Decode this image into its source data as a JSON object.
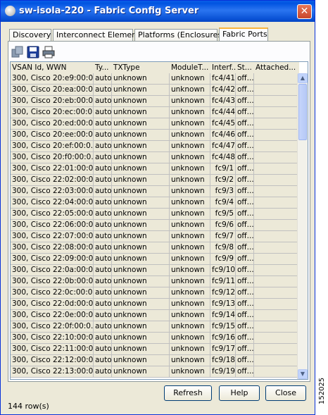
{
  "window": {
    "title": "sw-isola-220 - Fabric Config Server",
    "close_symbol": "✕"
  },
  "tabs": [
    {
      "label": "Discovery",
      "active": false
    },
    {
      "label": "Interconnect Elements",
      "active": false
    },
    {
      "label": "Platforms (Enclosures)",
      "active": false
    },
    {
      "label": "Fabric Ports",
      "active": true
    }
  ],
  "toolbar": {
    "icons": [
      "copy-icon",
      "save-icon",
      "print-icon"
    ]
  },
  "table": {
    "columns": [
      "VSAN Id, WWN",
      "Ty...",
      "TXType",
      "ModuleT...",
      "Interf...",
      "St...",
      "Attached..."
    ],
    "rows": [
      [
        "300, Cisco 20:e9:00:0...",
        "auto",
        "unknown",
        "unknown",
        "fc4/41",
        "off..."
      ],
      [
        "300, Cisco 20:ea:00:0...",
        "auto",
        "unknown",
        "unknown",
        "fc4/42",
        "off..."
      ],
      [
        "300, Cisco 20:eb:00:0...",
        "auto",
        "unknown",
        "unknown",
        "fc4/43",
        "off..."
      ],
      [
        "300, Cisco 20:ec:00:0...",
        "auto",
        "unknown",
        "unknown",
        "fc4/44",
        "off..."
      ],
      [
        "300, Cisco 20:ed:00:0...",
        "auto",
        "unknown",
        "unknown",
        "fc4/45",
        "off..."
      ],
      [
        "300, Cisco 20:ee:00:0...",
        "auto",
        "unknown",
        "unknown",
        "fc4/46",
        "off..."
      ],
      [
        "300, Cisco 20:ef:00:0...",
        "auto",
        "unknown",
        "unknown",
        "fc4/47",
        "off..."
      ],
      [
        "300, Cisco 20:f0:00:0...",
        "auto",
        "unknown",
        "unknown",
        "fc4/48",
        "off..."
      ],
      [
        "300, Cisco 22:01:00:0...",
        "auto",
        "unknown",
        "unknown",
        "fc9/1",
        "off..."
      ],
      [
        "300, Cisco 22:02:00:0...",
        "auto",
        "unknown",
        "unknown",
        "fc9/2",
        "off..."
      ],
      [
        "300, Cisco 22:03:00:0...",
        "auto",
        "unknown",
        "unknown",
        "fc9/3",
        "off..."
      ],
      [
        "300, Cisco 22:04:00:0...",
        "auto",
        "unknown",
        "unknown",
        "fc9/4",
        "off..."
      ],
      [
        "300, Cisco 22:05:00:0...",
        "auto",
        "unknown",
        "unknown",
        "fc9/5",
        "off..."
      ],
      [
        "300, Cisco 22:06:00:0...",
        "auto",
        "unknown",
        "unknown",
        "fc9/6",
        "off..."
      ],
      [
        "300, Cisco 22:07:00:0...",
        "auto",
        "unknown",
        "unknown",
        "fc9/7",
        "off..."
      ],
      [
        "300, Cisco 22:08:00:0...",
        "auto",
        "unknown",
        "unknown",
        "fc9/8",
        "off..."
      ],
      [
        "300, Cisco 22:09:00:0...",
        "auto",
        "unknown",
        "unknown",
        "fc9/9",
        "off..."
      ],
      [
        "300, Cisco 22:0a:00:0...",
        "auto",
        "unknown",
        "unknown",
        "fc9/10",
        "off..."
      ],
      [
        "300, Cisco 22:0b:00:0...",
        "auto",
        "unknown",
        "unknown",
        "fc9/11",
        "off..."
      ],
      [
        "300, Cisco 22:0c:00:0...",
        "auto",
        "unknown",
        "unknown",
        "fc9/12",
        "off..."
      ],
      [
        "300, Cisco 22:0d:00:0...",
        "auto",
        "unknown",
        "unknown",
        "fc9/13",
        "off..."
      ],
      [
        "300, Cisco 22:0e:00:0...",
        "auto",
        "unknown",
        "unknown",
        "fc9/14",
        "off..."
      ],
      [
        "300, Cisco 22:0f:00:0...",
        "auto",
        "unknown",
        "unknown",
        "fc9/15",
        "off..."
      ],
      [
        "300, Cisco 22:10:00:0...",
        "auto",
        "unknown",
        "unknown",
        "fc9/16",
        "off..."
      ],
      [
        "300, Cisco 22:11:00:0...",
        "auto",
        "unknown",
        "unknown",
        "fc9/17",
        "off..."
      ],
      [
        "300, Cisco 22:12:00:0...",
        "auto",
        "unknown",
        "unknown",
        "fc9/18",
        "off..."
      ],
      [
        "300, Cisco 22:13:00:0...",
        "auto",
        "unknown",
        "unknown",
        "fc9/19",
        "off..."
      ]
    ]
  },
  "buttons": {
    "refresh": "Refresh",
    "help": "Help",
    "close": "Close"
  },
  "status": {
    "row_count": "144 row(s)"
  },
  "figure_id": "152025",
  "colors": {
    "title_bar": "#0053e1",
    "active_tab_accent": "#f9b43c",
    "window_bg": "#ece9d8"
  }
}
